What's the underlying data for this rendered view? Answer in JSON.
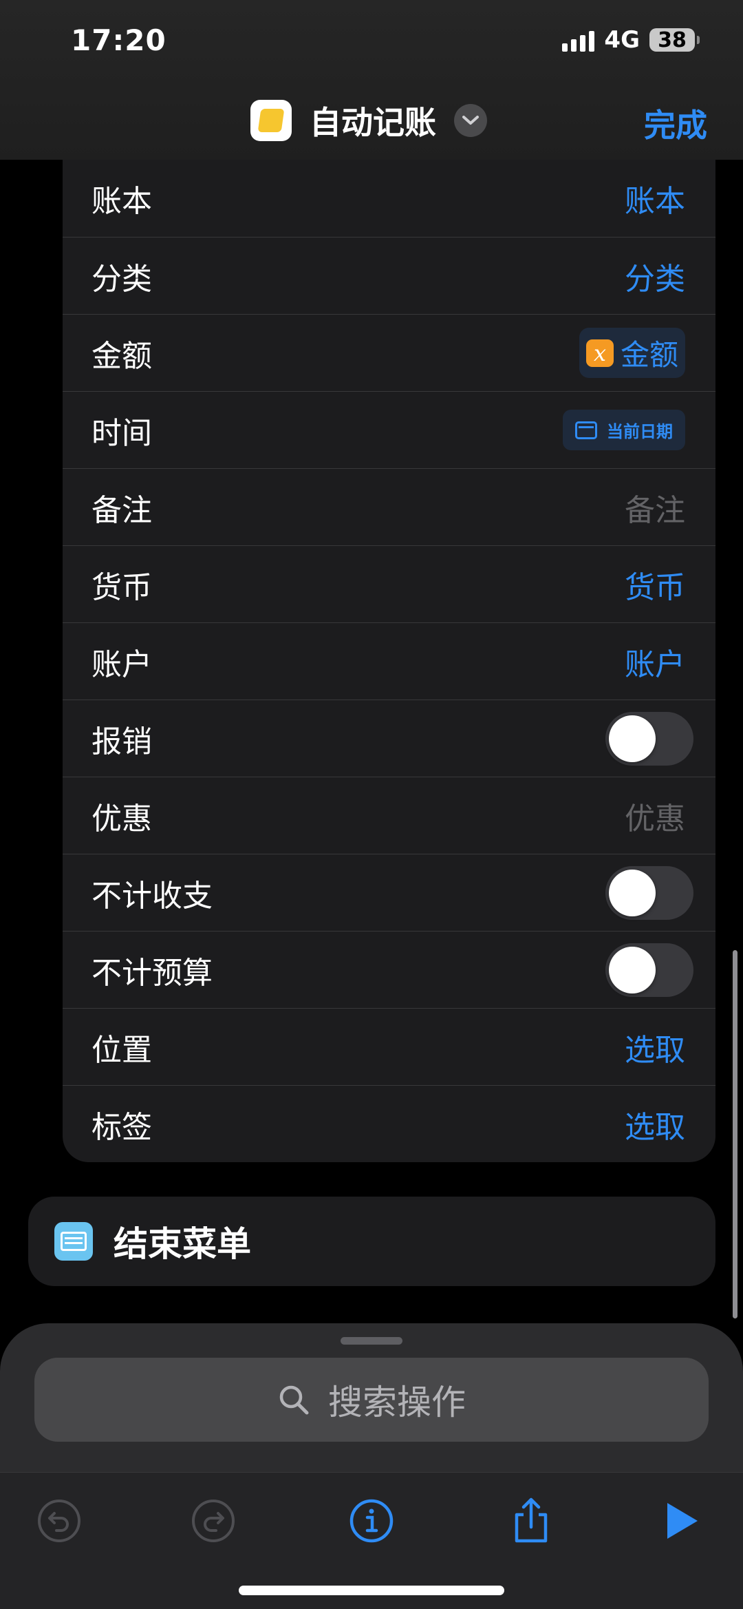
{
  "status_bar": {
    "time": "17:20",
    "network": "4G",
    "battery": "38"
  },
  "nav": {
    "title": "自动记账",
    "done_label": "完成"
  },
  "rows": [
    {
      "label": "账本",
      "value": "账本",
      "type": "link"
    },
    {
      "label": "分类",
      "value": "分类",
      "type": "link"
    },
    {
      "label": "金额",
      "value": "金额",
      "type": "variable",
      "badge": "x"
    },
    {
      "label": "时间",
      "value": "当前日期",
      "type": "date"
    },
    {
      "label": "备注",
      "value": "备注",
      "type": "placeholder"
    },
    {
      "label": "货币",
      "value": "货币",
      "type": "link"
    },
    {
      "label": "账户",
      "value": "账户",
      "type": "link"
    },
    {
      "label": "报销",
      "type": "toggle",
      "on": false
    },
    {
      "label": "优惠",
      "value": "优惠",
      "type": "placeholder"
    },
    {
      "label": "不计收支",
      "type": "toggle",
      "on": false
    },
    {
      "label": "不计预算",
      "type": "toggle",
      "on": false
    },
    {
      "label": "位置",
      "value": "选取",
      "type": "link"
    },
    {
      "label": "标签",
      "value": "选取",
      "type": "link"
    }
  ],
  "end_menu": {
    "label": "结束菜单"
  },
  "search": {
    "placeholder": "搜索操作"
  },
  "toolbar": {
    "icons": [
      "undo-icon",
      "redo-icon",
      "info-icon",
      "share-icon",
      "play-icon"
    ]
  },
  "colors": {
    "accent": "#2f8cf5",
    "variable_badge": "#f59a23",
    "background": "#000000",
    "card": "#1c1c1e"
  }
}
